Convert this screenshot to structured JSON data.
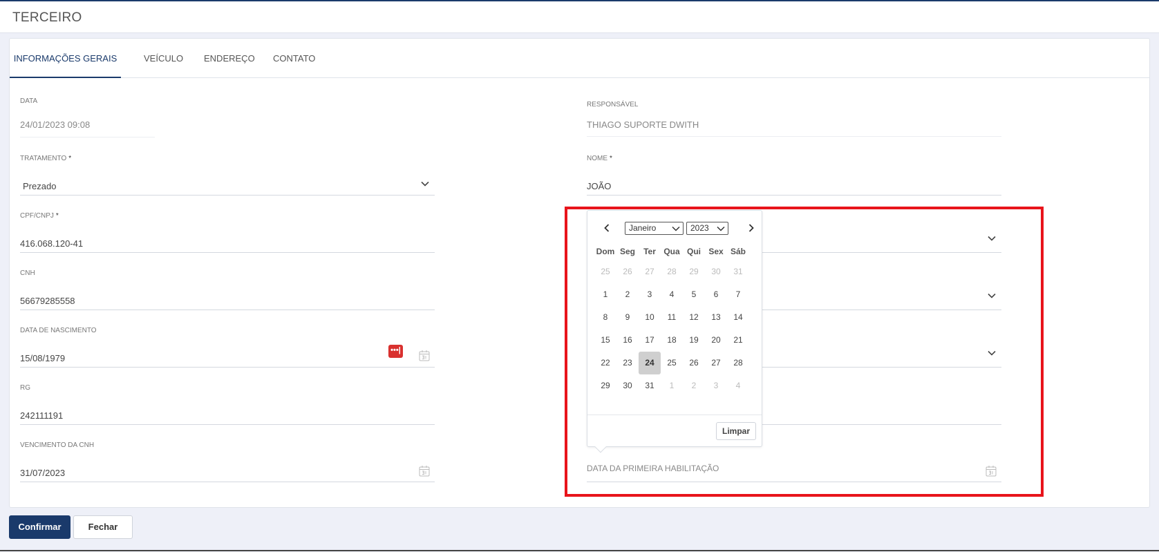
{
  "header": {
    "title": "TERCEIRO"
  },
  "tabs": [
    {
      "label": "INFORMAÇÕES GERAIS",
      "active": true
    },
    {
      "label": "VEÍCULO",
      "active": false
    },
    {
      "label": "ENDEREÇO",
      "active": false
    },
    {
      "label": "CONTATO",
      "active": false
    }
  ],
  "left_fields": {
    "data": {
      "label": "DATA",
      "value": "24/01/2023 09:08"
    },
    "tratamento": {
      "label": "TRATAMENTO",
      "required": "*",
      "value": "Prezado"
    },
    "cpf": {
      "label": "CPF/CNPJ",
      "required": "*",
      "value": "416.068.120-41"
    },
    "cnh": {
      "label": "CNH",
      "value": "56679285558"
    },
    "nascimento": {
      "label": "DATA DE NASCIMENTO",
      "value": "15/08/1979"
    },
    "rg": {
      "label": "RG",
      "value": "242111191"
    },
    "vencimento": {
      "label": "VENCIMENTO DA CNH",
      "value": "31/07/2023"
    }
  },
  "right_fields": {
    "responsavel": {
      "label": "RESPONSÁVEL",
      "value": "THIAGO SUPORTE DWITH"
    },
    "nome": {
      "label": "NOME",
      "required": "*",
      "value": "JOÃO"
    },
    "primeira_hab": {
      "placeholder": "DATA DA PRIMEIRA HABILITAÇÃO"
    }
  },
  "password_badge": "•••|",
  "datepicker": {
    "month": "Janeiro",
    "year": "2023",
    "weekdays": [
      "Dom",
      "Seg",
      "Ter",
      "Qua",
      "Qui",
      "Sex",
      "Sáb"
    ],
    "weeks": [
      [
        "25",
        "26",
        "27",
        "28",
        "29",
        "30",
        "31"
      ],
      [
        "1",
        "2",
        "3",
        "4",
        "5",
        "6",
        "7"
      ],
      [
        "8",
        "9",
        "10",
        "11",
        "12",
        "13",
        "14"
      ],
      [
        "15",
        "16",
        "17",
        "18",
        "19",
        "20",
        "21"
      ],
      [
        "22",
        "23",
        "24",
        "25",
        "26",
        "27",
        "28"
      ],
      [
        "29",
        "30",
        "31",
        "1",
        "2",
        "3",
        "4"
      ]
    ],
    "selected_day": "24",
    "clear_label": "Limpar"
  },
  "buttons": {
    "confirm": "Confirmar",
    "close": "Fechar"
  },
  "colors": {
    "primary": "#1a3a6b",
    "highlight": "#e8141b",
    "badge": "#d9312f"
  }
}
